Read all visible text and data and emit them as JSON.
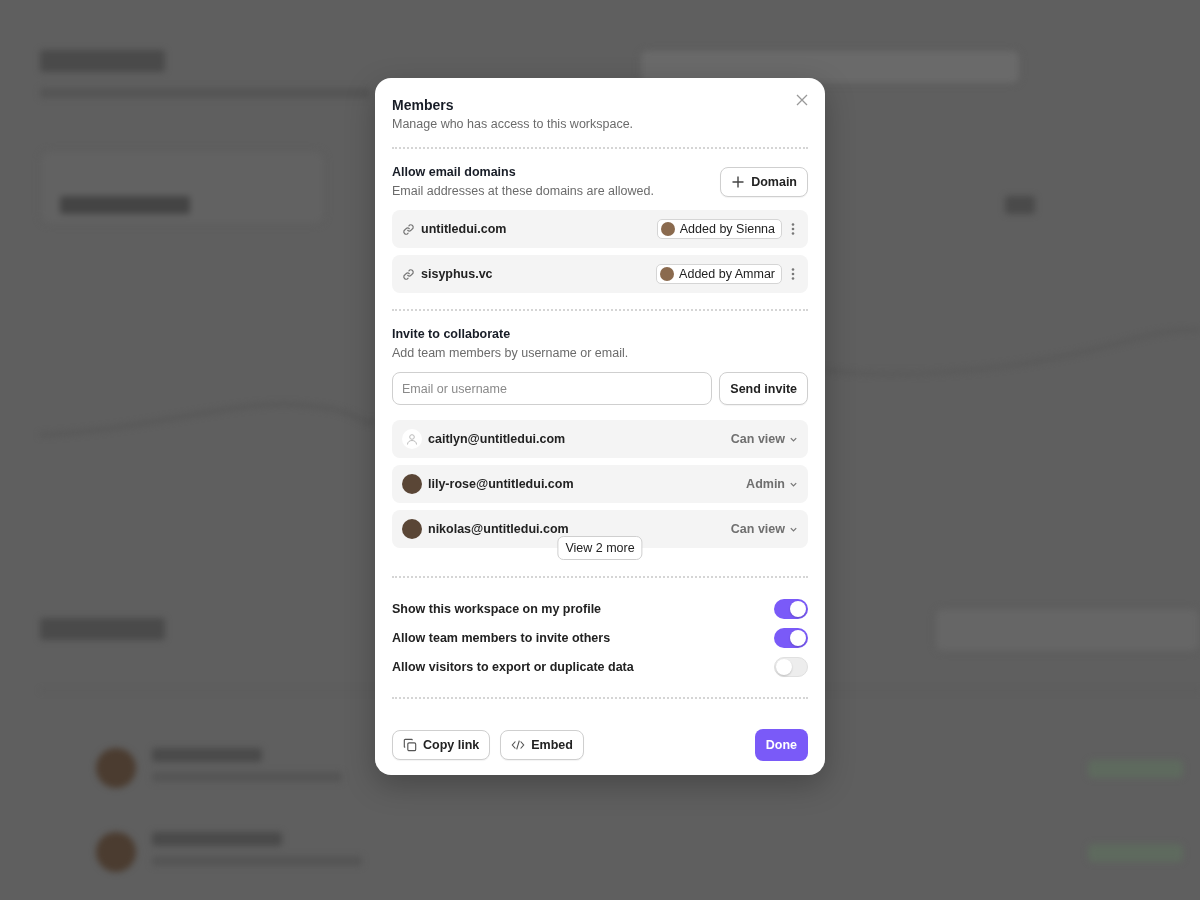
{
  "dialog": {
    "title": "Members",
    "subtitle": "Manage who has access to this workspace."
  },
  "domains": {
    "title": "Allow email domains",
    "description": "Email addresses at these domains are allowed.",
    "add_button": "Domain",
    "items": [
      {
        "domain": "untitledui.com",
        "added_by": "Added by Sienna"
      },
      {
        "domain": "sisyphus.vc",
        "added_by": "Added by Ammar"
      }
    ]
  },
  "invite": {
    "title": "Invite to collaborate",
    "description": "Add team members by username or email.",
    "placeholder": "Email or username",
    "send_button": "Send invite",
    "members": [
      {
        "email": "caitlyn@untitledui.com",
        "role": "Can view",
        "kind": "placeholder"
      },
      {
        "email": "lily-rose@untitledui.com",
        "role": "Admin",
        "kind": "photo"
      },
      {
        "email": "nikolas@untitledui.com",
        "role": "Can view",
        "kind": "photo"
      }
    ],
    "more_button": "View 2 more"
  },
  "settings": [
    {
      "label": "Show this workspace on my profile",
      "on": true
    },
    {
      "label": "Allow team members to invite others",
      "on": true
    },
    {
      "label": "Allow visitors to export or duplicate data",
      "on": false
    }
  ],
  "footer": {
    "copy_button": "Copy link",
    "embed_button": "Embed",
    "done_button": "Done"
  }
}
